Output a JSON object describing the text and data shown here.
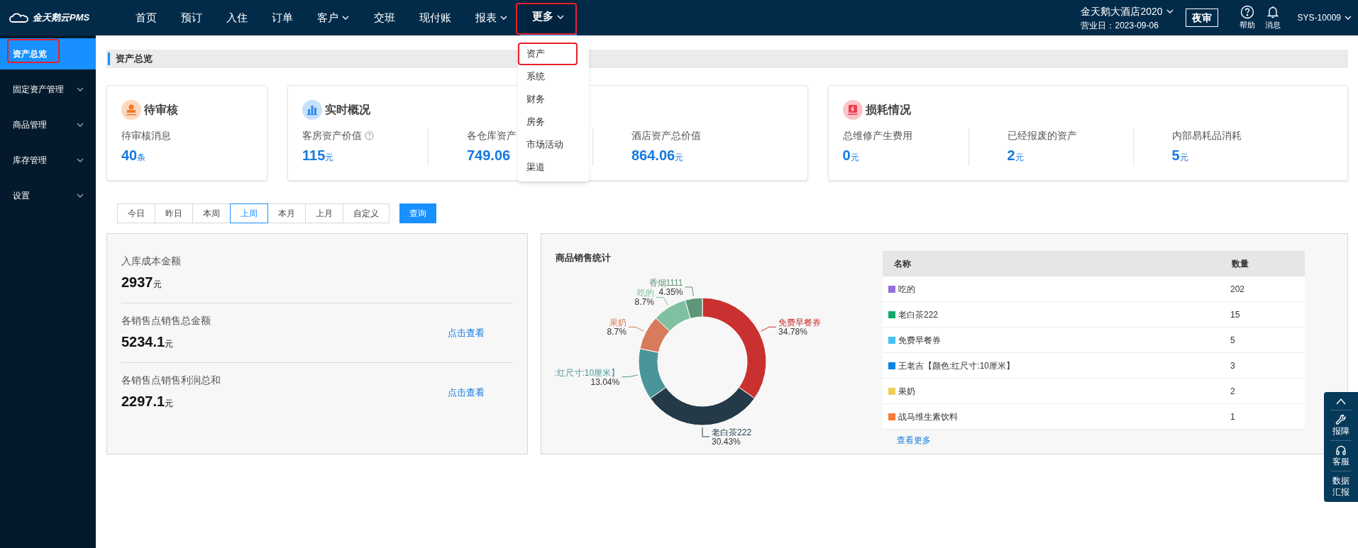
{
  "brand": "金天鹅云PMS",
  "nav": [
    {
      "label": "首页",
      "selected": false,
      "dropdown": false
    },
    {
      "label": "预订",
      "selected": false,
      "dropdown": false
    },
    {
      "label": "入住",
      "selected": false,
      "dropdown": false
    },
    {
      "label": "订单",
      "selected": false,
      "dropdown": false
    },
    {
      "label": "客户",
      "selected": false,
      "dropdown": true
    },
    {
      "label": "交班",
      "selected": false,
      "dropdown": false
    },
    {
      "label": "现付账",
      "selected": false,
      "dropdown": false
    },
    {
      "label": "报表",
      "selected": false,
      "dropdown": true
    },
    {
      "label": "更多",
      "selected": true,
      "dropdown": true
    }
  ],
  "hotel": {
    "name": "金天鹅大酒店2020",
    "business_date": "营业日：2023-09-06"
  },
  "night_audit": "夜审",
  "help": "帮助",
  "messages": "消息",
  "user": "SYS-10009",
  "more_menu": {
    "items": [
      {
        "label": "资产",
        "highlighted": true
      },
      {
        "label": "系统",
        "highlighted": false
      },
      {
        "label": "财务",
        "highlighted": false
      },
      {
        "label": "房务",
        "highlighted": false
      },
      {
        "label": "市场活动",
        "highlighted": false
      },
      {
        "label": "渠道",
        "highlighted": false
      }
    ]
  },
  "sidebar": {
    "items": [
      {
        "label": "资产总览",
        "selected": true,
        "expandable": false
      },
      {
        "label": "固定资产管理",
        "selected": false,
        "expandable": true
      },
      {
        "label": "商品管理",
        "selected": false,
        "expandable": true
      },
      {
        "label": "库存管理",
        "selected": false,
        "expandable": true
      },
      {
        "label": "设置",
        "selected": false,
        "expandable": true
      }
    ]
  },
  "page_title": "资产总览",
  "cards": [
    {
      "title": "待审核",
      "kind": "stamp",
      "stats": [
        {
          "label": "待审核消息",
          "value": "40",
          "unit": "条"
        }
      ]
    },
    {
      "title": "实时概况",
      "kind": "chart",
      "stats": [
        {
          "label": "客房资产价值",
          "info": true,
          "value": "115",
          "unit": "元"
        },
        {
          "label": "各仓库资产",
          "value": "749.06"
        },
        {
          "label": "酒店资产总价值",
          "value": "864.06",
          "unit": "元"
        }
      ]
    },
    {
      "title": "损耗情况",
      "kind": "alert",
      "stats": [
        {
          "label": "总维修产生费用",
          "value": "0",
          "unit": "元"
        },
        {
          "label": "已经报废的资产",
          "value": "2",
          "unit": "元"
        },
        {
          "label": "内部易耗品消耗",
          "value": "5",
          "unit": "元"
        }
      ]
    }
  ],
  "periods": [
    {
      "label": "今日",
      "selected": false
    },
    {
      "label": "昨日",
      "selected": false
    },
    {
      "label": "本周",
      "selected": false
    },
    {
      "label": "上周",
      "selected": true
    },
    {
      "label": "本月",
      "selected": false
    },
    {
      "label": "上月",
      "selected": false
    },
    {
      "label": "自定义",
      "selected": false
    }
  ],
  "query_button": "查询",
  "summary": [
    {
      "label": "入库成本金额",
      "value": "2937",
      "unit": "元"
    },
    {
      "label": "各销售点销售总金额",
      "value": "5234.1",
      "unit": "元",
      "link": "点击查看"
    },
    {
      "label": "各销售点销售利润总和",
      "value": "2297.1",
      "unit": "元",
      "link": "点击查看"
    }
  ],
  "sales": {
    "title": "商品销售统计",
    "chart_data": {
      "type": "donut",
      "categories": [
        "免费早餐券",
        "老白茶222",
        ":红尺寸:10厘米】",
        "果奶",
        "吃的",
        "香烟1111"
      ],
      "values": [
        34.78,
        30.43,
        13.04,
        8.7,
        8.7,
        4.35
      ],
      "colors": [
        "#c8312f",
        "#253a48",
        "#4a9599",
        "#d87a5c",
        "#7fc0a0",
        "#5e9679"
      ],
      "value_labels": [
        "34.78%",
        "30.43%",
        "13.04%",
        "8.7%",
        "8.7%",
        "4.35%"
      ]
    },
    "table": {
      "columns": [
        "名称",
        "数量"
      ],
      "rows": [
        {
          "name": "吃的",
          "count": "202",
          "color": "#9370db"
        },
        {
          "name": "老白茶222",
          "count": "15",
          "color": "#0fa86d"
        },
        {
          "name": "免费早餐券",
          "count": "5",
          "color": "#47c1f3"
        },
        {
          "name": "王老吉【颜色:红尺寸:10厘米】",
          "count": "3",
          "color": "#0a84e8"
        },
        {
          "name": "果奶",
          "count": "2",
          "color": "#ecd05a"
        },
        {
          "name": "战马维生素饮料",
          "count": "1",
          "color": "#fb7c3c"
        }
      ]
    },
    "more_link": "查看更多"
  },
  "float_tools": [
    {
      "label": "报障",
      "kind": "wrench"
    },
    {
      "label": "客服",
      "kind": "headset"
    },
    {
      "label": "数据汇报",
      "kind": "data"
    }
  ]
}
